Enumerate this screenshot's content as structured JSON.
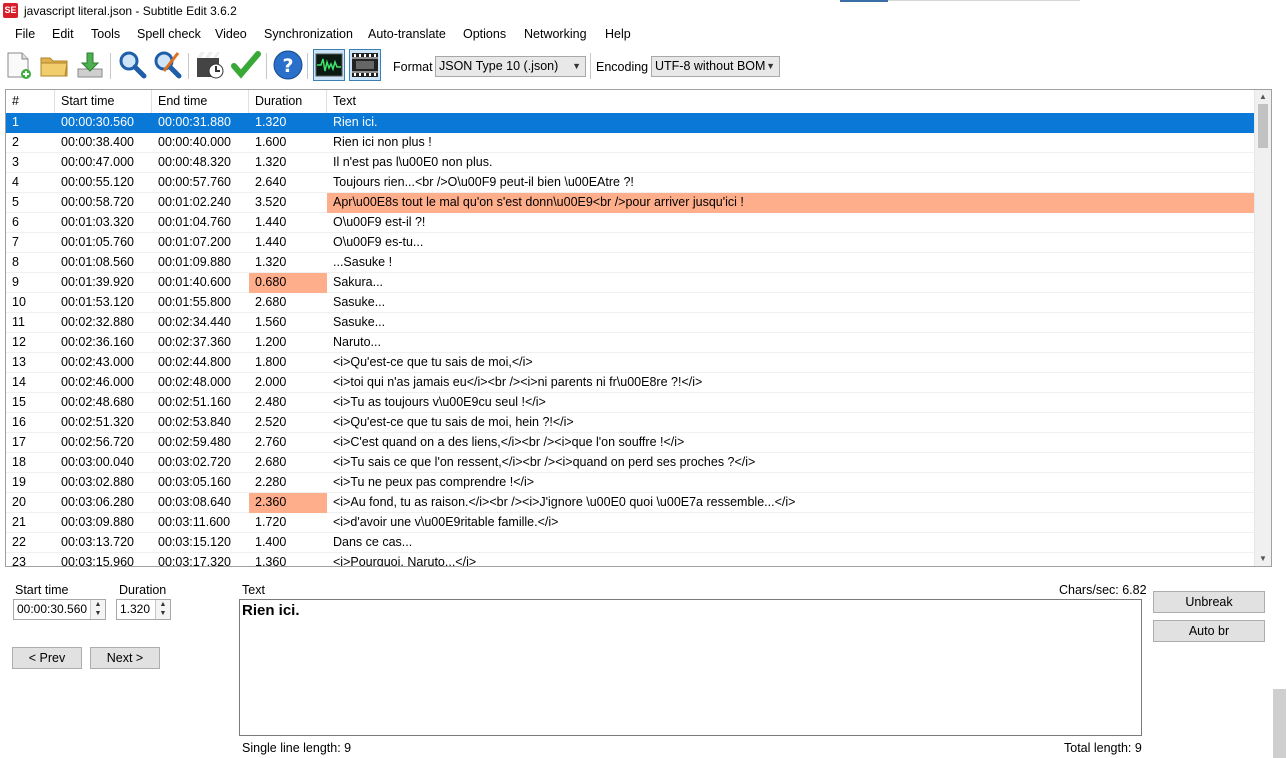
{
  "window": {
    "title": "javascript literal.json - Subtitle Edit 3.6.2",
    "app_icon_text": "SE"
  },
  "menu": [
    "File",
    "Edit",
    "Tools",
    "Spell check",
    "Video",
    "Synchronization",
    "Auto-translate",
    "Options",
    "Networking",
    "Help"
  ],
  "toolbar": {
    "icons": [
      "new-file-icon",
      "open-folder-icon",
      "download-icon",
      "find-icon",
      "replace-icon",
      "visual-sync-icon",
      "spell-check-icon",
      "help-icon",
      "waveform-icon",
      "video-icon"
    ],
    "format_label": "Format",
    "format_value": "JSON Type 10 (.json)",
    "encoding_label": "Encoding",
    "encoding_value": "UTF-8 without BOM"
  },
  "grid": {
    "columns": [
      "#",
      "Start time",
      "End time",
      "Duration",
      "Text"
    ],
    "highlight_color": "#ffae8c",
    "selected_color": "#0a78d7",
    "rows": [
      {
        "num": "1",
        "start": "00:00:30.560",
        "end": "00:00:31.880",
        "duration": "1.320",
        "text": "Rien ici.",
        "selected": true
      },
      {
        "num": "2",
        "start": "00:00:38.400",
        "end": "00:00:40.000",
        "duration": "1.600",
        "text": "Rien ici non plus !"
      },
      {
        "num": "3",
        "start": "00:00:47.000",
        "end": "00:00:48.320",
        "duration": "1.320",
        "text": "Il n'est pas l\\u00E0 non plus."
      },
      {
        "num": "4",
        "start": "00:00:55.120",
        "end": "00:00:57.760",
        "duration": "2.640",
        "text": "Toujours rien...<br />O\\u00F9 peut-il bien \\u00EAtre ?!"
      },
      {
        "num": "5",
        "start": "00:00:58.720",
        "end": "00:01:02.240",
        "duration": "3.520",
        "text": "Apr\\u00E8s tout le mal qu'on s'est donn\\u00E9<br />pour arriver jusqu'ici !",
        "text_highlight": true
      },
      {
        "num": "6",
        "start": "00:01:03.320",
        "end": "00:01:04.760",
        "duration": "1.440",
        "text": "O\\u00F9 est-il ?!"
      },
      {
        "num": "7",
        "start": "00:01:05.760",
        "end": "00:01:07.200",
        "duration": "1.440",
        "text": "O\\u00F9 es-tu..."
      },
      {
        "num": "8",
        "start": "00:01:08.560",
        "end": "00:01:09.880",
        "duration": "1.320",
        "text": "...Sasuke !"
      },
      {
        "num": "9",
        "start": "00:01:39.920",
        "end": "00:01:40.600",
        "duration": "0.680",
        "text": "Sakura...",
        "duration_highlight": true
      },
      {
        "num": "10",
        "start": "00:01:53.120",
        "end": "00:01:55.800",
        "duration": "2.680",
        "text": "Sasuke..."
      },
      {
        "num": "11",
        "start": "00:02:32.880",
        "end": "00:02:34.440",
        "duration": "1.560",
        "text": "Sasuke..."
      },
      {
        "num": "12",
        "start": "00:02:36.160",
        "end": "00:02:37.360",
        "duration": "1.200",
        "text": "Naruto..."
      },
      {
        "num": "13",
        "start": "00:02:43.000",
        "end": "00:02:44.800",
        "duration": "1.800",
        "text": "<i>Qu'est-ce que tu sais de moi,</i>"
      },
      {
        "num": "14",
        "start": "00:02:46.000",
        "end": "00:02:48.000",
        "duration": "2.000",
        "text": "<i>toi qui n'as jamais eu</i><br /><i>ni parents ni fr\\u00E8re ?!</i>"
      },
      {
        "num": "15",
        "start": "00:02:48.680",
        "end": "00:02:51.160",
        "duration": "2.480",
        "text": "<i>Tu as toujours v\\u00E9cu seul !</i>"
      },
      {
        "num": "16",
        "start": "00:02:51.320",
        "end": "00:02:53.840",
        "duration": "2.520",
        "text": "<i>Qu'est-ce que tu sais de moi, hein ?!</i>"
      },
      {
        "num": "17",
        "start": "00:02:56.720",
        "end": "00:02:59.480",
        "duration": "2.760",
        "text": "<i>C'est quand on a des liens,</i><br /><i>que l'on souffre !</i>"
      },
      {
        "num": "18",
        "start": "00:03:00.040",
        "end": "00:03:02.720",
        "duration": "2.680",
        "text": "<i>Tu sais ce que l'on ressent,</i><br /><i>quand on perd ses proches ?</i>"
      },
      {
        "num": "19",
        "start": "00:03:02.880",
        "end": "00:03:05.160",
        "duration": "2.280",
        "text": "<i>Tu ne peux pas comprendre !</i>"
      },
      {
        "num": "20",
        "start": "00:03:06.280",
        "end": "00:03:08.640",
        "duration": "2.360",
        "text": "<i>Au fond, tu as raison.</i><br /><i>J'ignore \\u00E0 quoi \\u00E7a ressemble...</i>",
        "duration_highlight": true
      },
      {
        "num": "21",
        "start": "00:03:09.880",
        "end": "00:03:11.600",
        "duration": "1.720",
        "text": "<i>d'avoir une v\\u00E9ritable famille.</i>"
      },
      {
        "num": "22",
        "start": "00:03:13.720",
        "end": "00:03:15.120",
        "duration": "1.400",
        "text": "Dans ce cas..."
      },
      {
        "num": "23",
        "start": "00:03:15.960",
        "end": "00:03:17.320",
        "duration": "1.360",
        "text": "<i>Pourquoi, Naruto...</i>"
      }
    ]
  },
  "editor": {
    "start_time_label": "Start time",
    "start_time_value": "00:00:30.560",
    "duration_label": "Duration",
    "duration_value": "1.320",
    "prev_label": "< Prev",
    "next_label": "Next >",
    "text_label": "Text",
    "chars_per_sec": "Chars/sec: 6.82",
    "text_value": "Rien ici.",
    "single_line_length": "Single line length: 9",
    "total_length": "Total length: 9",
    "unbreak_label": "Unbreak",
    "auto_br_label": "Auto br"
  }
}
